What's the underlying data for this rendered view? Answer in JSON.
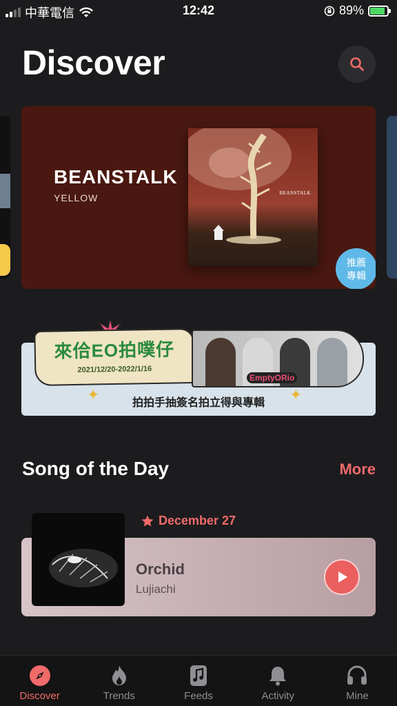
{
  "status_bar": {
    "carrier": "中華電信",
    "time": "12:42",
    "battery": "89%",
    "battery_level": 0.89
  },
  "header": {
    "title": "Discover"
  },
  "hero": {
    "title": "BEANSTALK",
    "subtitle": "YELLOW",
    "cover_text": "BEANSTALK",
    "badge_line1": "推薦",
    "badge_line2": "專輯"
  },
  "banner": {
    "title": "來佮EO拍噗仔",
    "date_range": "2021/12/20-2022/1/16",
    "brand": "EmptyORio",
    "caption": "拍拍手抽簽名拍立得與專輯"
  },
  "song_of_the_day": {
    "section_title": "Song of the Day",
    "more_label": "More",
    "date": "December 27",
    "song_title": "Orchid",
    "artist": "Lujiachi"
  },
  "tabs": [
    {
      "label": "Discover",
      "icon": "compass-icon",
      "active": true
    },
    {
      "label": "Trends",
      "icon": "flame-icon",
      "active": false
    },
    {
      "label": "Feeds",
      "icon": "music-note-icon",
      "active": false
    },
    {
      "label": "Activity",
      "icon": "bell-icon",
      "active": false
    },
    {
      "label": "Mine",
      "icon": "headphones-icon",
      "active": false
    }
  ],
  "colors": {
    "background": "#1c1c1e",
    "accent": "#f06a6a",
    "hero_bg": "#4a1810",
    "badge": "#5fb9e8"
  }
}
